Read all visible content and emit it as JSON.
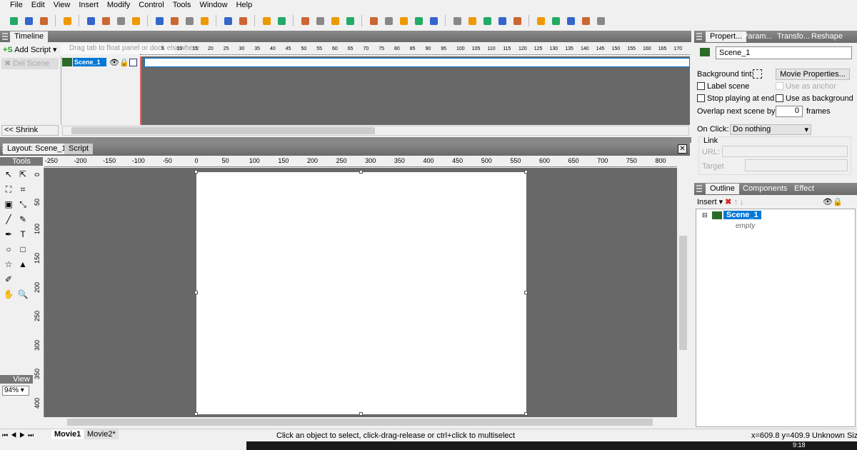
{
  "menu": [
    "File",
    "Edit",
    "View",
    "Insert",
    "Modify",
    "Control",
    "Tools",
    "Window",
    "Help"
  ],
  "toolbar_icons": [
    "new-icon",
    "open-icon",
    "save-icon",
    "sep",
    "publish-icon",
    "sep",
    "cut-icon",
    "copy-icon",
    "paste-icon",
    "delete-icon",
    "sep",
    "bring-forward-icon",
    "send-backward-icon",
    "bring-front-icon",
    "send-back-icon",
    "sep",
    "undo-icon",
    "redo-icon",
    "sep",
    "help-icon",
    "context-help-icon",
    "sep",
    "stop-icon",
    "play-icon",
    "play-scene-icon",
    "play-effect-icon",
    "sep",
    "first-frame-icon",
    "rewind-icon",
    "step-icon",
    "forward-icon",
    "last-frame-icon",
    "sep",
    "add-scene-icon",
    "add-movie-icon",
    "add-clip-icon",
    "add-effect-icon",
    "add-sound-icon",
    "sep",
    "effect1-icon",
    "effect2-icon",
    "effect3-icon",
    "effect4-icon",
    "effect5-icon"
  ],
  "timeline": {
    "tab": "Timeline",
    "add_script": "Add Script",
    "del_scene": "Del Scene",
    "shrink": "<< Shrink",
    "drag_hint": "Drag tab to float panel or dock elsewhere",
    "scene": "Scene_1",
    "frame_ticks": [
      5,
      10,
      15,
      20,
      25,
      30,
      35,
      40,
      45,
      50,
      55,
      60,
      65,
      70,
      75,
      80,
      85,
      90,
      95,
      100,
      105,
      110,
      115,
      120,
      125,
      130,
      135,
      140,
      145,
      150,
      155,
      160,
      165,
      170
    ]
  },
  "layout": {
    "tabs": [
      "Layout: Scene_1",
      "Script"
    ],
    "tools_label": "Tools",
    "view_label": "View",
    "zoom": "94%",
    "h_ticks": [
      -250,
      -200,
      -150,
      -100,
      -50,
      0,
      50,
      100,
      150,
      200,
      250,
      300,
      350,
      400,
      450,
      500,
      550,
      600,
      650,
      700,
      750,
      800
    ],
    "v_ticks": [
      0,
      50,
      100,
      150,
      200,
      250,
      300,
      350,
      400
    ]
  },
  "movies": [
    "Movie1",
    "Movie2*"
  ],
  "status": {
    "hint": "Click an object to select, click-drag-release or ctrl+click to multiselect",
    "coords": "x=609.8 y=409.9",
    "size": "Unknown Size"
  },
  "properties": {
    "tabs": [
      "Propert...",
      "Param...",
      "Transfo...",
      "Reshape"
    ],
    "name": "Scene_1",
    "bg_tint": "Background tint:",
    "movie_props": "Movie Properties...",
    "label_scene": "Label scene",
    "use_anchor": "Use as anchor",
    "stop_end": "Stop playing at end",
    "use_bg": "Use as background",
    "overlap": "Overlap next scene by:",
    "overlap_val": "0",
    "frames": "frames",
    "onclick": "On Click:",
    "onclick_val": "Do nothing",
    "link": "Link",
    "url": "URL:",
    "target": "Target"
  },
  "outline": {
    "tabs": [
      "Outline",
      "Components",
      "Effect"
    ],
    "insert": "Insert",
    "scene": "Scene_1",
    "empty": "empty"
  },
  "taskbar": {
    "time": "9:18"
  },
  "colors": {
    "accent": "#0078d7",
    "canvas_bg": "#686868"
  }
}
